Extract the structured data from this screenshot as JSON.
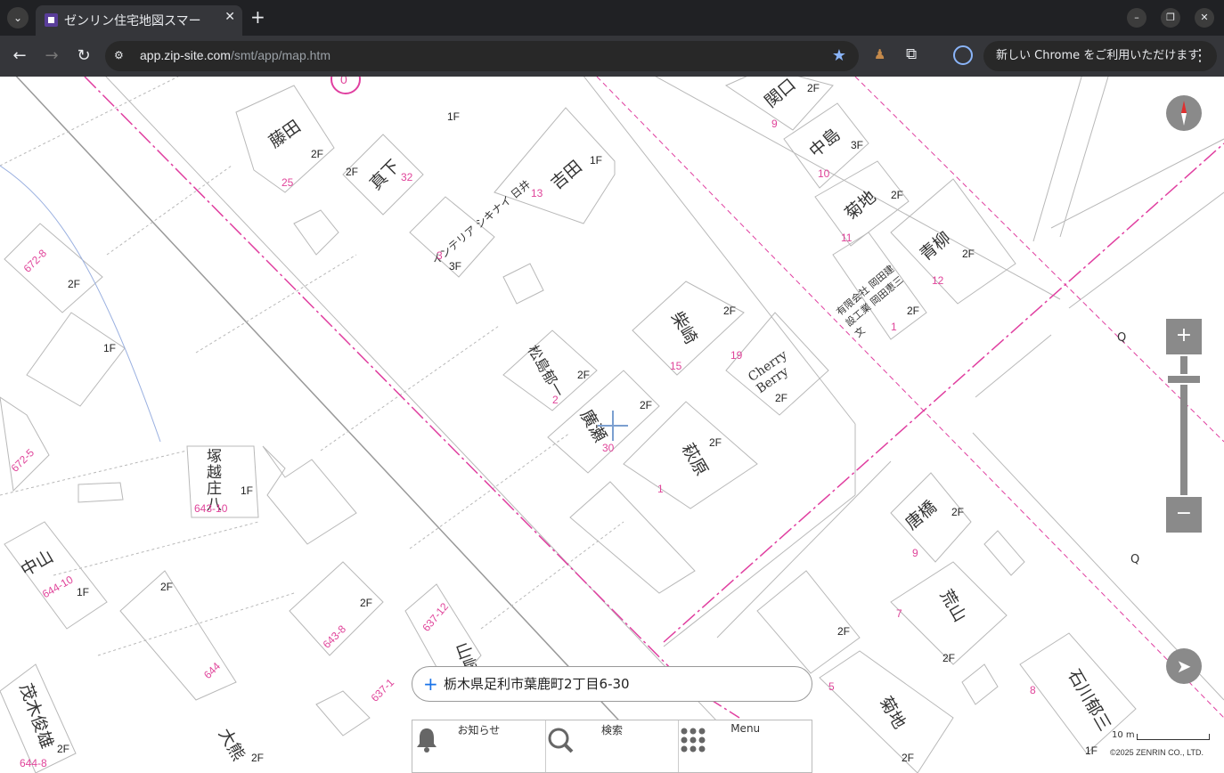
{
  "browser": {
    "tab_title": "ゼンリン住宅地図スマー",
    "url_domain": "app.zip-site.com",
    "url_path": "/smt/app/map.htm",
    "update_text": "新しい Chrome をご利用いただけます"
  },
  "map": {
    "buildings": [
      {
        "name": "藤田",
        "lot": "25",
        "floor": "2F"
      },
      {
        "name": "真下",
        "lot": "32",
        "floor": "2F"
      },
      {
        "name": "吉田",
        "lot": "13",
        "floor": "1F"
      },
      {
        "name": "インテリア シキナイ 日井",
        "lot": "3",
        "floor": "3F"
      },
      {
        "name": "関口",
        "lot": "9",
        "floor": "2F"
      },
      {
        "name": "中島",
        "lot": "10",
        "floor": "3F"
      },
      {
        "name": "菊地",
        "lot": "11",
        "floor": "2F"
      },
      {
        "name": "青柳",
        "lot": "12",
        "floor": "2F"
      },
      {
        "name": "有限会社 岡田建設工業 岡田恵三文",
        "lot": "1",
        "floor": "2F"
      },
      {
        "name": "柴崎",
        "lot": "15",
        "floor": "2F"
      },
      {
        "name": "Cherry Berry",
        "lot": "19",
        "floor": "2F"
      },
      {
        "name": "松島郁一",
        "lot": "2",
        "floor": "2F"
      },
      {
        "name": "廣瀬",
        "lot": "30",
        "floor": "2F"
      },
      {
        "name": "萩原",
        "lot": "1",
        "floor": "2F"
      },
      {
        "name": "塚越庄八",
        "lot": "643-10",
        "floor": "1F"
      },
      {
        "name": "中山",
        "lot": "644-10",
        "floor": "1F"
      },
      {
        "name": "唐橋",
        "lot": "9",
        "floor": "2F"
      },
      {
        "name": "荒山",
        "lot": "7",
        "floor": "2F"
      },
      {
        "name": "菊地",
        "lot": "5",
        "floor": "2F"
      },
      {
        "name": "石川郁三",
        "lot": "8",
        "floor": "1F"
      },
      {
        "name": "茂木俊雄",
        "lot": "644-8",
        "floor": "2F"
      },
      {
        "name": "大熊",
        "lot": "",
        "floor": "2F"
      },
      {
        "name": "山崎",
        "lot": "637-12",
        "floor": ""
      }
    ],
    "lots": [
      "672-8",
      "672-5",
      "644",
      "643-8",
      "637-1"
    ],
    "floors_misc": [
      "2F",
      "1F",
      "1F",
      "2F",
      "2F",
      "2F"
    ],
    "circle_label": "0"
  },
  "search": {
    "address": "栃木県足利市葉鹿町2丁目6-30"
  },
  "nav": [
    {
      "label": "お知らせ",
      "icon": "bell-icon"
    },
    {
      "label": "検索",
      "icon": "search-icon"
    },
    {
      "label": "Menu",
      "icon": "grid-icon"
    }
  ],
  "controls": {
    "zoom_in": "+",
    "zoom_out": "−"
  },
  "scale": "10 m",
  "copyright": "©2025 ZENRIN CO., LTD."
}
